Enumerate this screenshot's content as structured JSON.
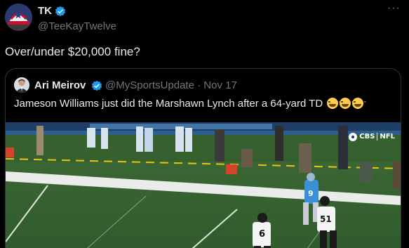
{
  "tweet": {
    "display_name": "TK",
    "handle": "@TeeKayTwelve",
    "more_icon": "more-horizontal-icon",
    "text": "Over/under $20,000 fine?"
  },
  "quote": {
    "display_name": "Ari Meirov",
    "handle": "@MySportsUpdate",
    "separator": "·",
    "date": "Nov 17",
    "text": "Jameson Williams just did the Marshawn Lynch after a 64-yard TD",
    "emojis": [
      "face-with-tears-of-joy",
      "face-with-tears-of-joy",
      "face-with-tears-of-joy"
    ]
  },
  "media": {
    "network_logo": "CBS",
    "league_label": "NFL",
    "jersey_numbers": [
      "9",
      "6",
      "51"
    ]
  },
  "colors": {
    "verified": "#1d9bf0",
    "background": "#000000",
    "secondary_text": "#71767b"
  }
}
